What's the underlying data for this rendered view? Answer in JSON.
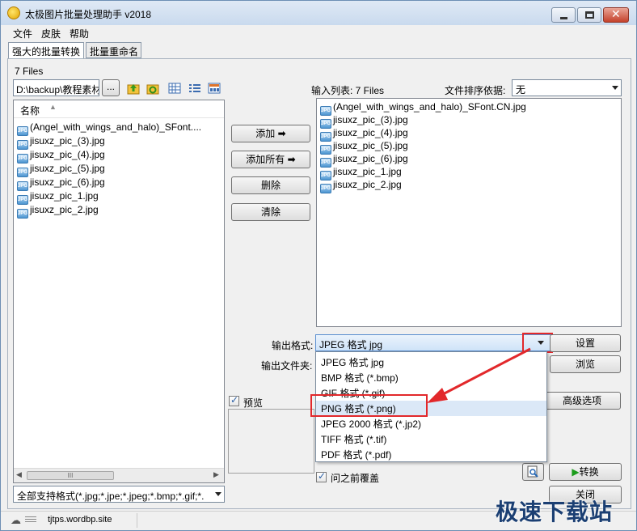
{
  "window": {
    "title": "太极图片批量处理助手  v2018"
  },
  "menu": [
    "文件",
    "皮肤",
    "帮助"
  ],
  "tabs": [
    "强大的批量转换",
    "批量重命名"
  ],
  "left": {
    "file_count": "7 Files",
    "path": "D:\\backup\\教程素材",
    "browse_label": "...",
    "column_name": "名称",
    "files": [
      "(Angel_with_wings_and_halo)_SFont....",
      "jisuxz_pic_(3).jpg",
      "jisuxz_pic_(4).jpg",
      "jisuxz_pic_(5).jpg",
      "jisuxz_pic_(6).jpg",
      "jisuxz_pic_1.jpg",
      "jisuxz_pic_2.jpg"
    ],
    "scroll_thumb": "III",
    "filter": "全部支持格式(*.jpg;*.jpe;*.jpeg;*.bmp;*.gif;*."
  },
  "middle": {
    "add": "添加",
    "add_all": "添加所有",
    "delete": "删除",
    "clear": "清除"
  },
  "right": {
    "input_list_label": "输入列表: 7 Files",
    "sort_label": "文件排序依据:",
    "sort_value": "无",
    "files": [
      "(Angel_with_wings_and_halo)_SFont.CN.jpg",
      "jisuxz_pic_(3).jpg",
      "jisuxz_pic_(4).jpg",
      "jisuxz_pic_(5).jpg",
      "jisuxz_pic_(6).jpg",
      "jisuxz_pic_1.jpg",
      "jisuxz_pic_2.jpg"
    ]
  },
  "output": {
    "format_label": "输出格式:",
    "format_value": "JPEG 格式 jpg",
    "folder_label": "输出文件夹:",
    "settings": "设置",
    "browse": "浏览",
    "advanced": "高级选项",
    "formats": [
      "JPEG 格式 jpg",
      "BMP 格式 (*.bmp)",
      "GIF 格式 (*.gif)",
      "PNG 格式 (*.png)",
      "JPEG 2000 格式 (*.jp2)",
      "TIFF 格式 (*.tif)",
      "PDF 格式 (*.pdf)"
    ],
    "highlighted_index": 3
  },
  "preview": {
    "label": "预览",
    "checked": true
  },
  "overwrite": {
    "label": "问之前覆盖",
    "checked": true
  },
  "actions": {
    "convert": "转换",
    "close": "关闭"
  },
  "status": {
    "url": "tjtps.wordbp.site"
  },
  "watermark": "极速下载站",
  "colors": {
    "annotation": "#e2282b",
    "title_bg": "#c9daee",
    "highlight": "#dbe8f7"
  }
}
